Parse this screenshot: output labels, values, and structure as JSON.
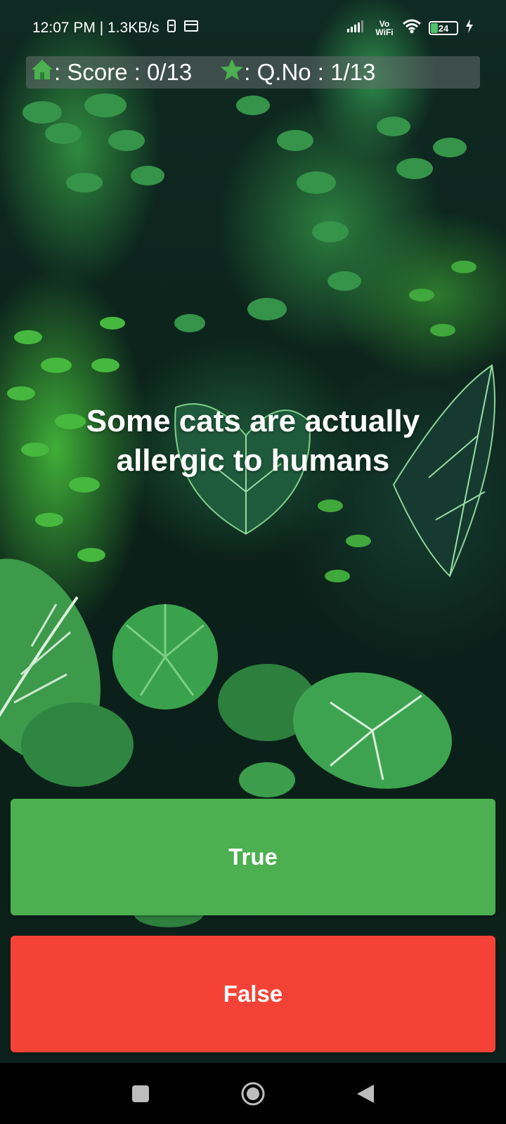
{
  "status_bar": {
    "time_speed": "12:07 PM | 1.3KB/s",
    "network": "Vo WiFi",
    "battery": "24"
  },
  "score_bar": {
    "score_label": ": Score : 0/13",
    "qno_label": ": Q.No : 1/13",
    "home_icon_color": "#4caf50",
    "star_icon_color": "#4caf50"
  },
  "question": {
    "text": "Some cats are actually allergic to humans"
  },
  "answers": {
    "true_label": "True",
    "false_label": "False",
    "true_color": "#4caf50",
    "false_color": "#f44336"
  },
  "nav_bar": {
    "icons": [
      "square-recent-icon",
      "circle-home-icon",
      "triangle-back-icon"
    ]
  }
}
